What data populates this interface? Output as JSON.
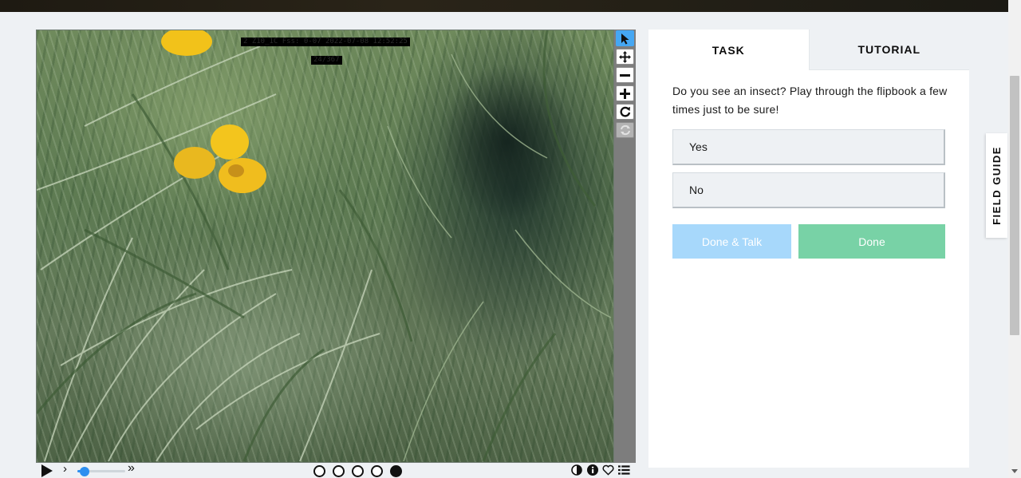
{
  "viewer": {
    "overlay_line_1": "2 Z10_1C Fss: 0-07  2022-07-08  12:52:25",
    "overlay_line_2": "24/367"
  },
  "toolbar": {
    "tools": [
      {
        "name": "pointer",
        "icon": "pointer-icon",
        "glyph": "➤",
        "active": true
      },
      {
        "name": "move",
        "icon": "move-icon",
        "glyph": "✥"
      },
      {
        "name": "zoom-out",
        "icon": "minus-icon",
        "glyph": "−"
      },
      {
        "name": "zoom-in",
        "icon": "plus-icon",
        "glyph": "+"
      },
      {
        "name": "rotate",
        "icon": "rotate-icon",
        "glyph": "↻"
      },
      {
        "name": "reset",
        "icon": "reset-icon",
        "glyph": "⟳",
        "disabled": true
      }
    ]
  },
  "controls": {
    "speed_chevron": "›",
    "speed_max": "»",
    "speed_level": 0.15,
    "frames": [
      false,
      false,
      false,
      false,
      true
    ]
  },
  "panel": {
    "tabs": {
      "task": "TASK",
      "tutorial": "TUTORIAL"
    },
    "question": "Do you see an insect? Play through the flipbook a few times just to be sure!",
    "answers": {
      "yes": "Yes",
      "no": "No"
    },
    "done_talk_label": "Done & Talk",
    "done_label": "Done"
  },
  "field_guide_label": "FIELD GUIDE",
  "colors": {
    "accent_blue": "#45a7f3",
    "done_green": "#78d2a6",
    "done_talk_blue": "#a7d8fb",
    "page_bg": "#eef1f4"
  }
}
